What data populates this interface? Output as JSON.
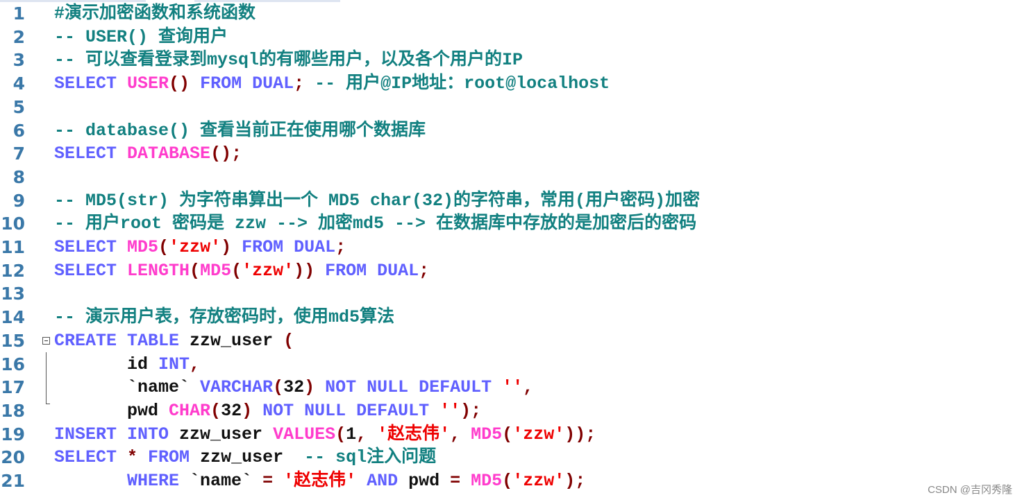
{
  "editor": {
    "lines": [
      {
        "n": "1",
        "tokens": [
          {
            "t": "cm",
            "v": "#演示加密函数和系统函数"
          }
        ]
      },
      {
        "n": "2",
        "tokens": [
          {
            "t": "cm",
            "v": "-- USER() 查询用户"
          }
        ]
      },
      {
        "n": "3",
        "tokens": [
          {
            "t": "cm",
            "v": "-- 可以查看登录到mysql的有哪些用户，以及各个用户的IP"
          }
        ]
      },
      {
        "n": "4",
        "tokens": [
          {
            "t": "kw",
            "v": "SELECT "
          },
          {
            "t": "fn",
            "v": "USER"
          },
          {
            "t": "pn",
            "v": "()"
          },
          {
            "t": "kw",
            "v": " FROM DUAL"
          },
          {
            "t": "pn",
            "v": ";"
          },
          {
            "t": "cm",
            "v": " -- 用户@IP地址：root@localhost"
          }
        ]
      },
      {
        "n": "5",
        "tokens": []
      },
      {
        "n": "6",
        "tokens": [
          {
            "t": "cm",
            "v": "-- database() 查看当前正在使用哪个数据库"
          }
        ]
      },
      {
        "n": "7",
        "tokens": [
          {
            "t": "kw",
            "v": "SELECT "
          },
          {
            "t": "fn",
            "v": "DATABASE"
          },
          {
            "t": "pn",
            "v": "();"
          }
        ]
      },
      {
        "n": "8",
        "tokens": []
      },
      {
        "n": "9",
        "tokens": [
          {
            "t": "cm",
            "v": "-- MD5(str) 为字符串算出一个 MD5 char(32)的字符串，常用(用户密码)加密"
          }
        ]
      },
      {
        "n": "10",
        "tokens": [
          {
            "t": "cm",
            "v": "-- 用户root 密码是 zzw --> 加密md5 --> 在数据库中存放的是加密后的密码"
          }
        ]
      },
      {
        "n": "11",
        "tokens": [
          {
            "t": "kw",
            "v": "SELECT "
          },
          {
            "t": "fn",
            "v": "MD5"
          },
          {
            "t": "pn",
            "v": "("
          },
          {
            "t": "st",
            "v": "'zzw'"
          },
          {
            "t": "pn",
            "v": ")"
          },
          {
            "t": "kw",
            "v": " FROM DUAL"
          },
          {
            "t": "pn",
            "v": ";"
          }
        ]
      },
      {
        "n": "12",
        "tokens": [
          {
            "t": "kw",
            "v": "SELECT "
          },
          {
            "t": "fn",
            "v": "LENGTH"
          },
          {
            "t": "pn",
            "v": "("
          },
          {
            "t": "fn",
            "v": "MD5"
          },
          {
            "t": "pn",
            "v": "("
          },
          {
            "t": "st",
            "v": "'zzw'"
          },
          {
            "t": "pn",
            "v": "))"
          },
          {
            "t": "kw",
            "v": " FROM DUAL"
          },
          {
            "t": "pn",
            "v": ";"
          }
        ]
      },
      {
        "n": "13",
        "tokens": []
      },
      {
        "n": "14",
        "tokens": [
          {
            "t": "cm",
            "v": "-- 演示用户表，存放密码时，使用md5算法"
          }
        ]
      },
      {
        "n": "15",
        "tokens": [
          {
            "t": "kw",
            "v": "CREATE TABLE "
          },
          {
            "t": "id",
            "v": "zzw_user "
          },
          {
            "t": "pn",
            "v": "("
          }
        ]
      },
      {
        "n": "16",
        "tokens": [
          {
            "t": "id",
            "v": "       id "
          },
          {
            "t": "kw",
            "v": "INT"
          },
          {
            "t": "pn",
            "v": ","
          }
        ]
      },
      {
        "n": "17",
        "tokens": [
          {
            "t": "id",
            "v": "       `name` "
          },
          {
            "t": "kw",
            "v": "VARCHAR"
          },
          {
            "t": "pn",
            "v": "("
          },
          {
            "t": "id",
            "v": "32"
          },
          {
            "t": "pn",
            "v": ")"
          },
          {
            "t": "kw",
            "v": " NOT NULL DEFAULT "
          },
          {
            "t": "st",
            "v": "''"
          },
          {
            "t": "pn",
            "v": ","
          }
        ]
      },
      {
        "n": "18",
        "tokens": [
          {
            "t": "id",
            "v": "       pwd "
          },
          {
            "t": "fn",
            "v": "CHAR"
          },
          {
            "t": "pn",
            "v": "("
          },
          {
            "t": "id",
            "v": "32"
          },
          {
            "t": "pn",
            "v": ")"
          },
          {
            "t": "kw",
            "v": " NOT NULL DEFAULT "
          },
          {
            "t": "st",
            "v": "''"
          },
          {
            "t": "pn",
            "v": ");"
          }
        ]
      },
      {
        "n": "19",
        "tokens": [
          {
            "t": "kw",
            "v": "INSERT INTO "
          },
          {
            "t": "id",
            "v": "zzw_user "
          },
          {
            "t": "fn",
            "v": "VALUES"
          },
          {
            "t": "pn",
            "v": "("
          },
          {
            "t": "id",
            "v": "1"
          },
          {
            "t": "pn",
            "v": ", "
          },
          {
            "t": "st",
            "v": "'赵志伟'"
          },
          {
            "t": "pn",
            "v": ", "
          },
          {
            "t": "fn",
            "v": "MD5"
          },
          {
            "t": "pn",
            "v": "("
          },
          {
            "t": "st",
            "v": "'zzw'"
          },
          {
            "t": "pn",
            "v": "));"
          }
        ]
      },
      {
        "n": "20",
        "tokens": [
          {
            "t": "kw",
            "v": "SELECT "
          },
          {
            "t": "pn",
            "v": "*"
          },
          {
            "t": "kw",
            "v": " FROM "
          },
          {
            "t": "id",
            "v": "zzw_user  "
          },
          {
            "t": "cm",
            "v": "-- sql注入问题"
          }
        ]
      },
      {
        "n": "21",
        "tokens": [
          {
            "t": "kw",
            "v": "       WHERE "
          },
          {
            "t": "id",
            "v": "`name` "
          },
          {
            "t": "pn",
            "v": "= "
          },
          {
            "t": "st",
            "v": "'赵志伟'"
          },
          {
            "t": "kw",
            "v": " AND "
          },
          {
            "t": "id",
            "v": "pwd "
          },
          {
            "t": "pn",
            "v": "= "
          },
          {
            "t": "fn",
            "v": "MD5"
          },
          {
            "t": "pn",
            "v": "("
          },
          {
            "t": "st",
            "v": "'zzw'"
          },
          {
            "t": "pn",
            "v": ");"
          }
        ]
      }
    ]
  },
  "watermark": "CSDN @吉冈秀隆"
}
